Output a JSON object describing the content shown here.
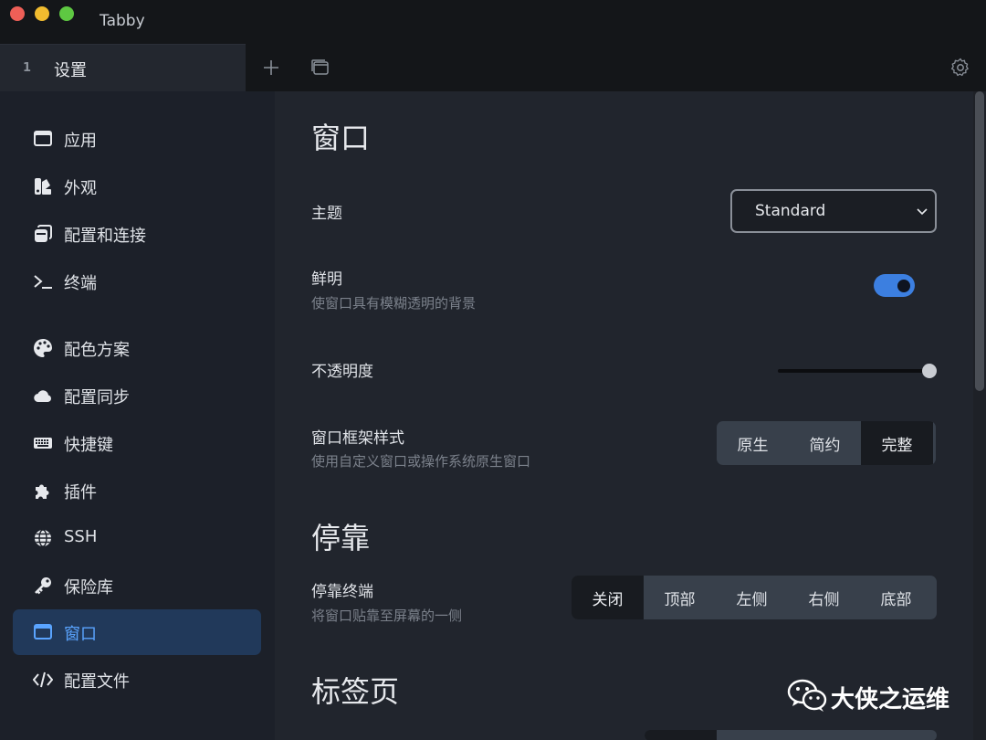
{
  "window": {
    "title": "Tabby"
  },
  "tabs": [
    {
      "number": "1",
      "label": "设置"
    }
  ],
  "sidebar": {
    "items": [
      {
        "label": "应用",
        "icon": "window-icon"
      },
      {
        "label": "外观",
        "icon": "swatches-icon"
      },
      {
        "label": "配置和连接",
        "icon": "profiles-icon"
      },
      {
        "label": "终端",
        "icon": "terminal-icon"
      },
      {
        "label": "配色方案",
        "icon": "palette-icon"
      },
      {
        "label": "配置同步",
        "icon": "cloud-icon"
      },
      {
        "label": "快捷键",
        "icon": "keyboard-icon"
      },
      {
        "label": "插件",
        "icon": "puzzle-icon"
      },
      {
        "label": "SSH",
        "icon": "globe-icon"
      },
      {
        "label": "保险库",
        "icon": "key-icon"
      },
      {
        "label": "窗口",
        "icon": "window-icon",
        "active": true
      },
      {
        "label": "配置文件",
        "icon": "code-icon"
      }
    ]
  },
  "main": {
    "window_section": {
      "title": "窗口",
      "theme": {
        "label": "主题",
        "value": "Standard"
      },
      "vibrancy": {
        "label": "鲜明",
        "description": "使窗口具有模糊透明的背景",
        "enabled": true
      },
      "opacity": {
        "label": "不透明度",
        "value": 1.0
      },
      "frame": {
        "label": "窗口框架样式",
        "description": "使用自定义窗口或操作系统原生窗口",
        "options": [
          "原生",
          "简约",
          "完整"
        ],
        "selected": "完整"
      }
    },
    "dock_section": {
      "title": "停靠",
      "dock": {
        "label": "停靠终端",
        "description": "将窗口贴靠至屏幕的一侧",
        "options": [
          "关闭",
          "顶部",
          "左侧",
          "右侧",
          "底部"
        ],
        "selected": "关闭"
      }
    },
    "tabs_section": {
      "title": "标签页"
    }
  },
  "watermark": {
    "text": "大侠之运维"
  },
  "colors": {
    "accent": "#3c7fe0",
    "active_item_bg": "#21395a",
    "active_item_text": "#5aa4ff",
    "background": "#21252d",
    "sidebar_bg": "#1c2029"
  }
}
